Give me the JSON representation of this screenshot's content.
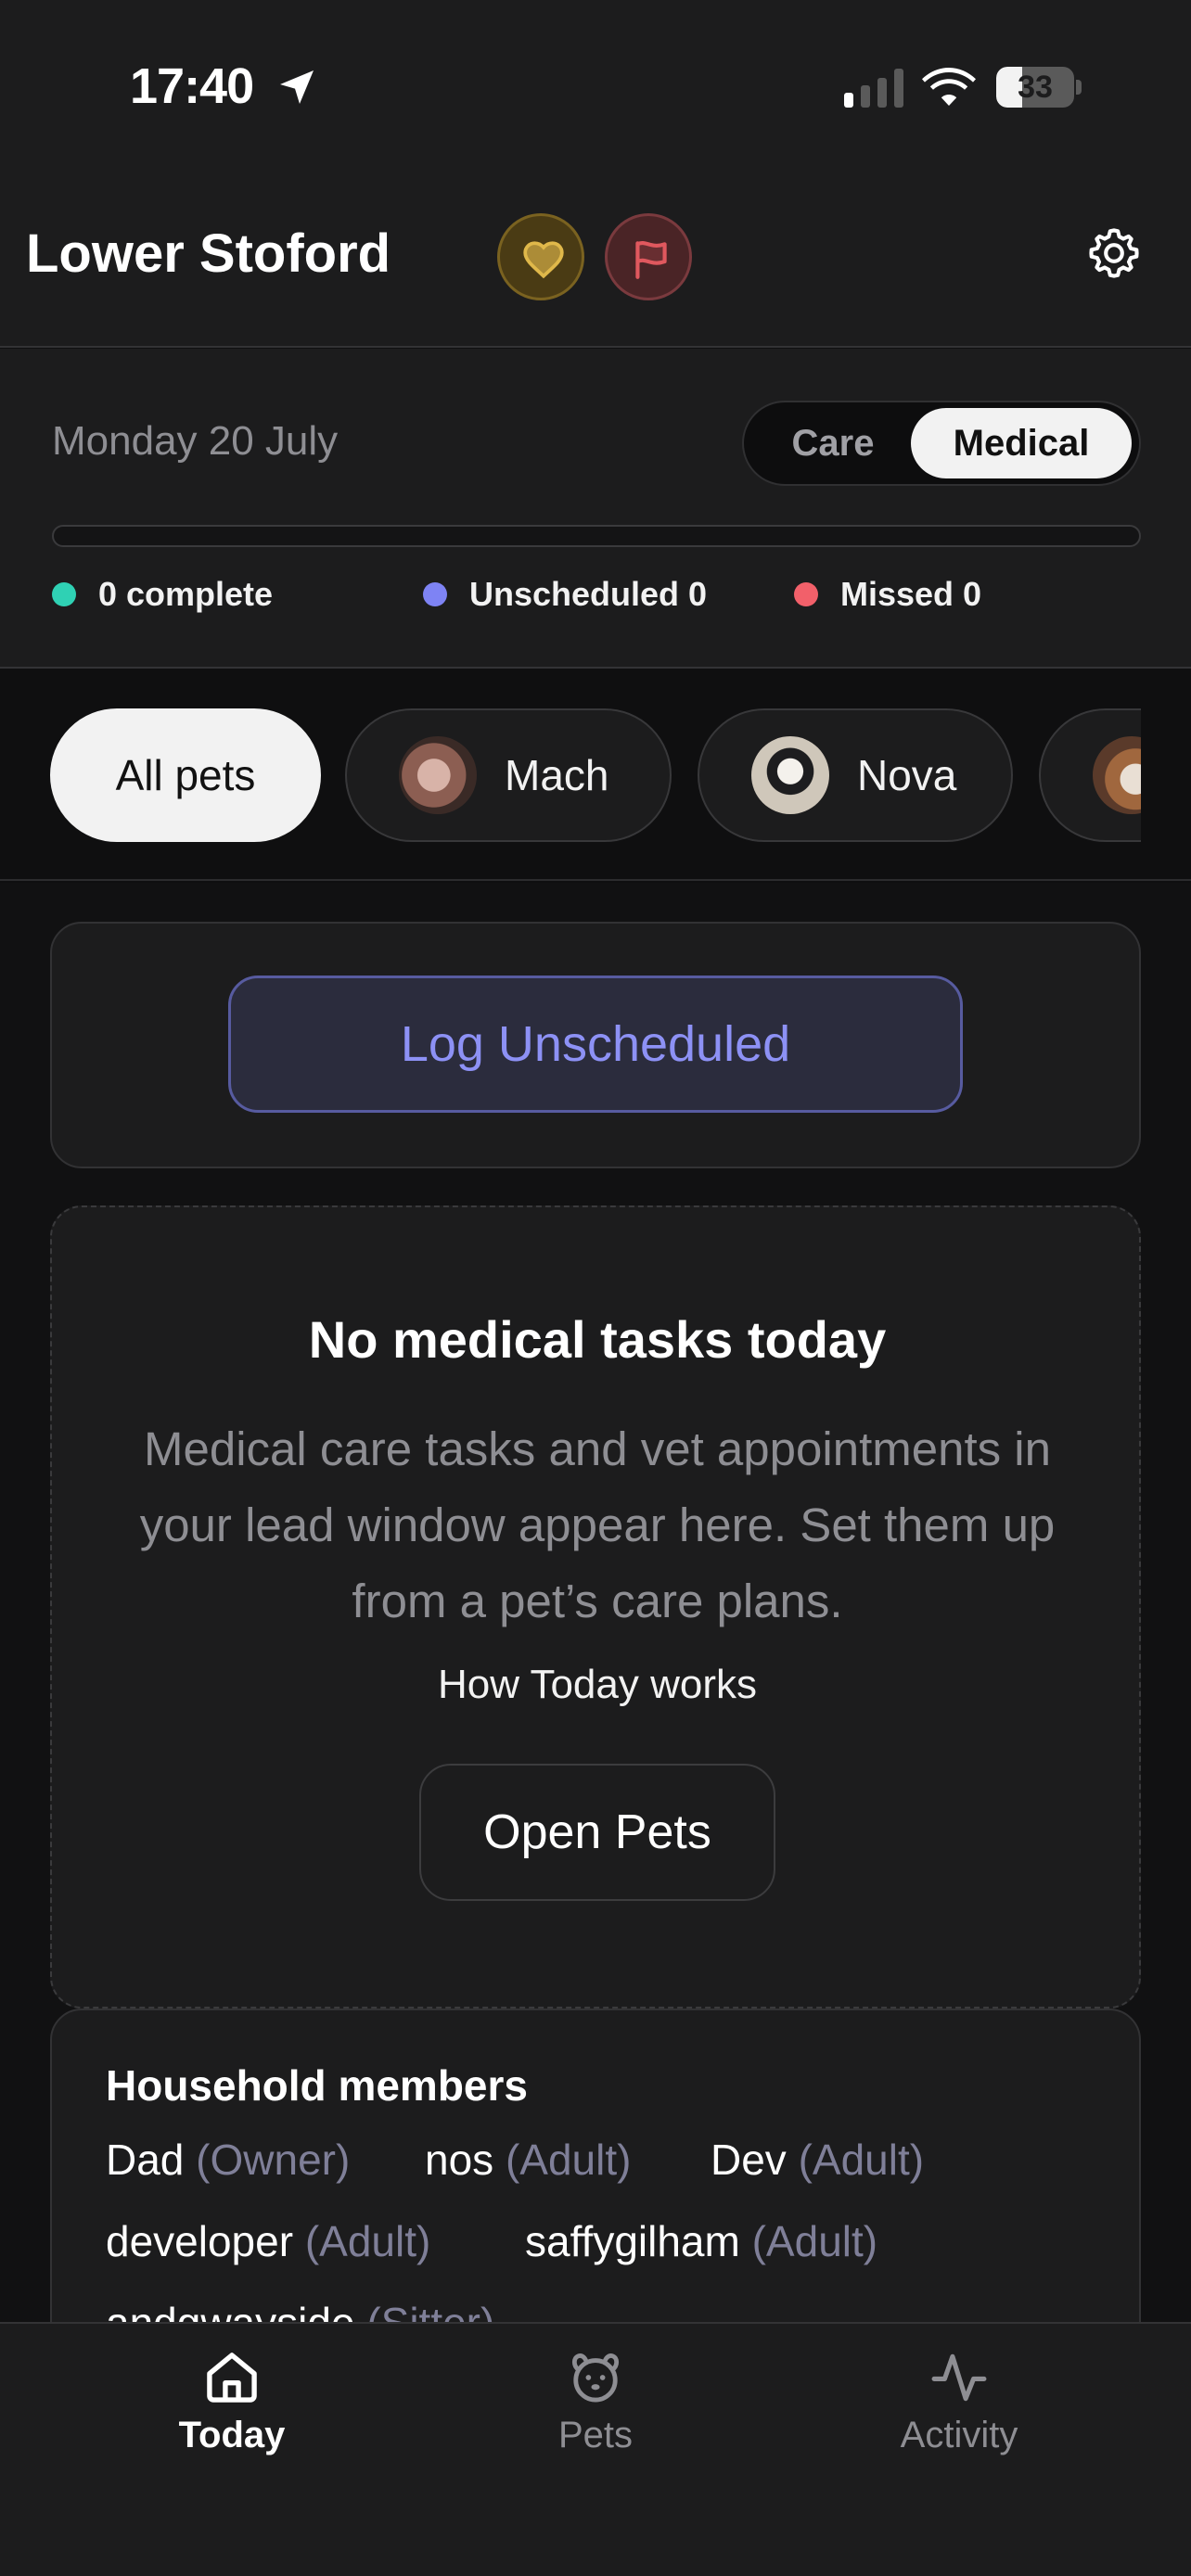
{
  "status_bar": {
    "time": "17:40",
    "battery_level": "33",
    "battery_fraction": 0.33
  },
  "header": {
    "household_name": "Lower Stoford",
    "icons": [
      "heart-icon",
      "flag-icon",
      "gear-icon"
    ],
    "colors": {
      "heart": "#e0b84a",
      "flag": "#e0585e"
    }
  },
  "summary": {
    "date": "Monday 20 July",
    "segments": {
      "care": "Care",
      "medical": "Medical",
      "selected": "Medical"
    },
    "progress_fraction": 0,
    "stats": {
      "complete": "0 complete",
      "unscheduled": "Unscheduled 0",
      "missed": "Missed 0"
    },
    "stat_colors": {
      "complete": "#2fd1b4",
      "unscheduled": "#7e83f4",
      "missed": "#f2606a"
    }
  },
  "pet_filter": {
    "all": "All pets",
    "pets": [
      {
        "name": "Mach"
      },
      {
        "name": "Nova"
      }
    ],
    "selected": "All pets"
  },
  "log_unscheduled": {
    "label": "Log Unscheduled"
  },
  "empty_state": {
    "title": "No medical tasks today",
    "description": "Medical care tasks and vet appointments in your lead window appear here. Set them up from a pet’s care plans.",
    "link": "How Today works",
    "button": "Open Pets"
  },
  "household": {
    "title": "Household members",
    "members": [
      {
        "name": "Dad",
        "role": "(Owner)"
      },
      {
        "name": "nos",
        "role": "(Adult)"
      },
      {
        "name": "Dev",
        "role": "(Adult)"
      },
      {
        "name": "developer",
        "role": "(Adult)"
      },
      {
        "name": "saffygilham",
        "role": "(Adult)"
      },
      {
        "name": "andgwayside",
        "role": "(Sitter)"
      }
    ]
  },
  "tabbar": {
    "today": "Today",
    "pets": "Pets",
    "activity": "Activity",
    "selected": "Today"
  }
}
